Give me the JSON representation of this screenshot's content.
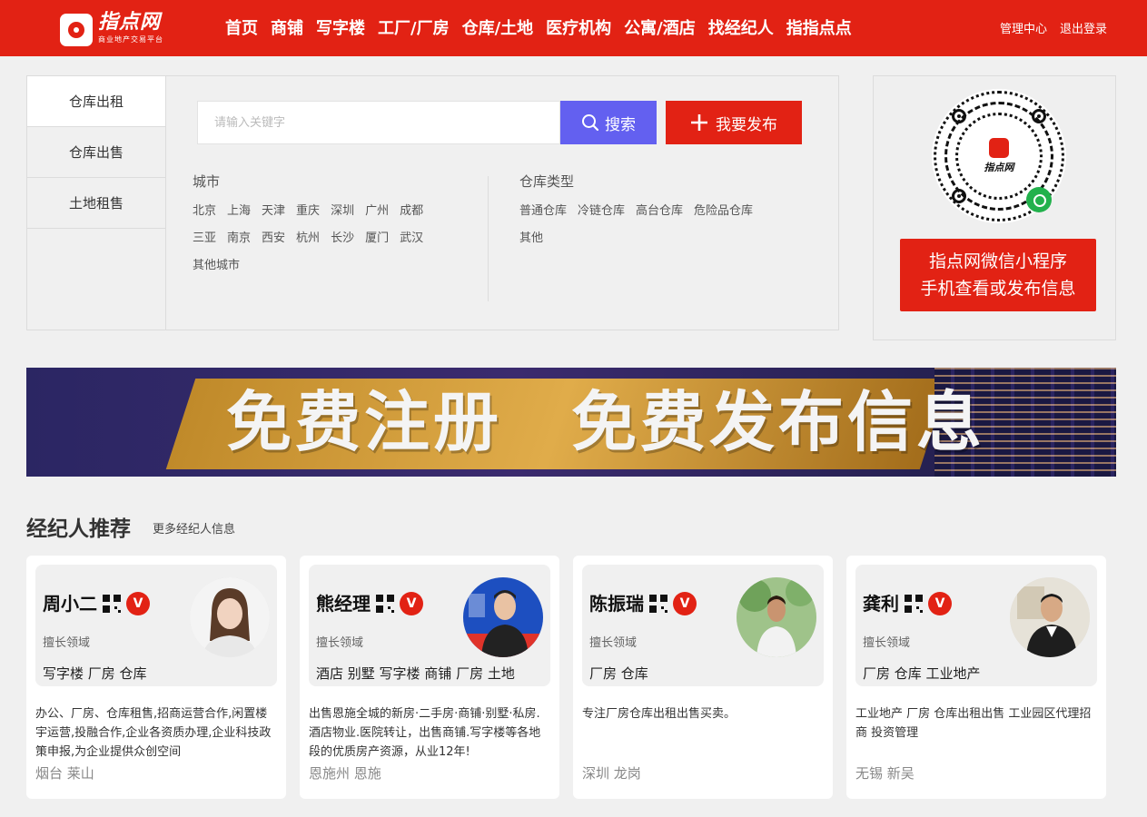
{
  "logo": {
    "name": "指点网",
    "sub": "商业地产交易平台"
  },
  "nav": [
    "首页",
    "商铺",
    "写字楼",
    "工厂/厂房",
    "仓库/土地",
    "医疗机构",
    "公寓/酒店",
    "找经纪人",
    "指指点点"
  ],
  "toplinks": {
    "manage": "管理中心",
    "logout": "退出登录"
  },
  "tabs": [
    "仓库出租",
    "仓库出售",
    "土地租售"
  ],
  "search": {
    "placeholder": "请输入关键字",
    "search_label": "搜索",
    "publish_label": "我要发布"
  },
  "filters": {
    "city_title": "城市",
    "cities": [
      "北京",
      "上海",
      "天津",
      "重庆",
      "深圳",
      "广州",
      "成都",
      "三亚",
      "南京",
      "西安",
      "杭州",
      "长沙",
      "厦门",
      "武汉",
      "其他城市"
    ],
    "type_title": "仓库类型",
    "types": [
      "普通仓库",
      "冷链仓库",
      "高台仓库",
      "危险品仓库",
      "其他"
    ]
  },
  "qr": {
    "logo_text": "指点网",
    "caption_line1": "指点网微信小程序",
    "caption_line2": "手机查看或发布信息"
  },
  "banner": {
    "text": "免费注册　免费发布信息"
  },
  "agents_section": {
    "title": "经纪人推荐",
    "more": "更多经纪人信息"
  },
  "agents": [
    {
      "name": "周小二",
      "badge": "V",
      "skill_label": "擅长领域",
      "skills": "写字楼 厂房 仓库",
      "desc": "办公、厂房、仓库租售,招商运营合作,闲置楼宇运营,投融合作,企业各资质办理,企业科技政策申报,为企业提供众创空间",
      "location": "烟台 莱山"
    },
    {
      "name": "熊经理",
      "badge": "V",
      "skill_label": "擅长领域",
      "skills": "酒店 别墅 写字楼 商铺 厂房 土地",
      "desc": "出售恩施全城的新房·二手房·商铺·别墅·私房.酒店物业.医院转让，出售商铺.写字楼等各地段的优质房产资源，从业12年!",
      "location": "恩施州 恩施"
    },
    {
      "name": "陈振瑞",
      "badge": "V",
      "skill_label": "擅长领域",
      "skills": "厂房 仓库",
      "desc": "专注厂房仓库出租出售买卖。",
      "location": "深圳 龙岗"
    },
    {
      "name": "龚利",
      "badge": "V",
      "skill_label": "擅长领域",
      "skills": "厂房 仓库 工业地产",
      "desc": "工业地产 厂房 仓库出租出售 工业园区代理招商 投资管理",
      "location": "无锡 新吴"
    }
  ],
  "colors": {
    "brand_red": "#e22214",
    "search_blue": "#6360f0",
    "bg": "#f0f0f0"
  }
}
